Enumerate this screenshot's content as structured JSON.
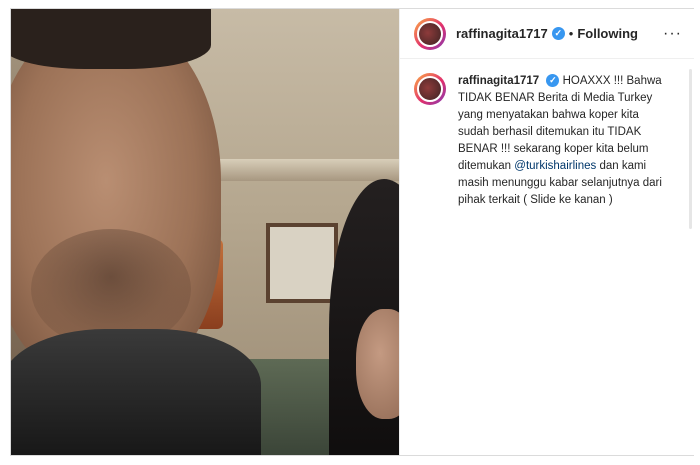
{
  "post": {
    "author": {
      "username": "raffinagita1717",
      "verified_icon": "verified-badge-icon",
      "follow_status": "Following",
      "separator": "•"
    },
    "more_icon": "more-options-icon",
    "more_label": "···",
    "caption": {
      "username": "raffinagita1717",
      "text_before_mention": "HOAXXX !!! Bahwa TIDAK BENAR Berita di Media Turkey yang menyatakan bahwa koper kita sudah berhasil ditemukan itu TIDAK BENAR !!! sekarang koper kita belum ditemukan ",
      "mention": "@turkishairlines",
      "text_after_mention": " dan kami masih menunggu kabar selanjutnya dari pihak terkait ( Slide ke kanan )"
    },
    "colors": {
      "verified": "#3897f0",
      "mention": "#00376b",
      "text": "#262626"
    }
  }
}
